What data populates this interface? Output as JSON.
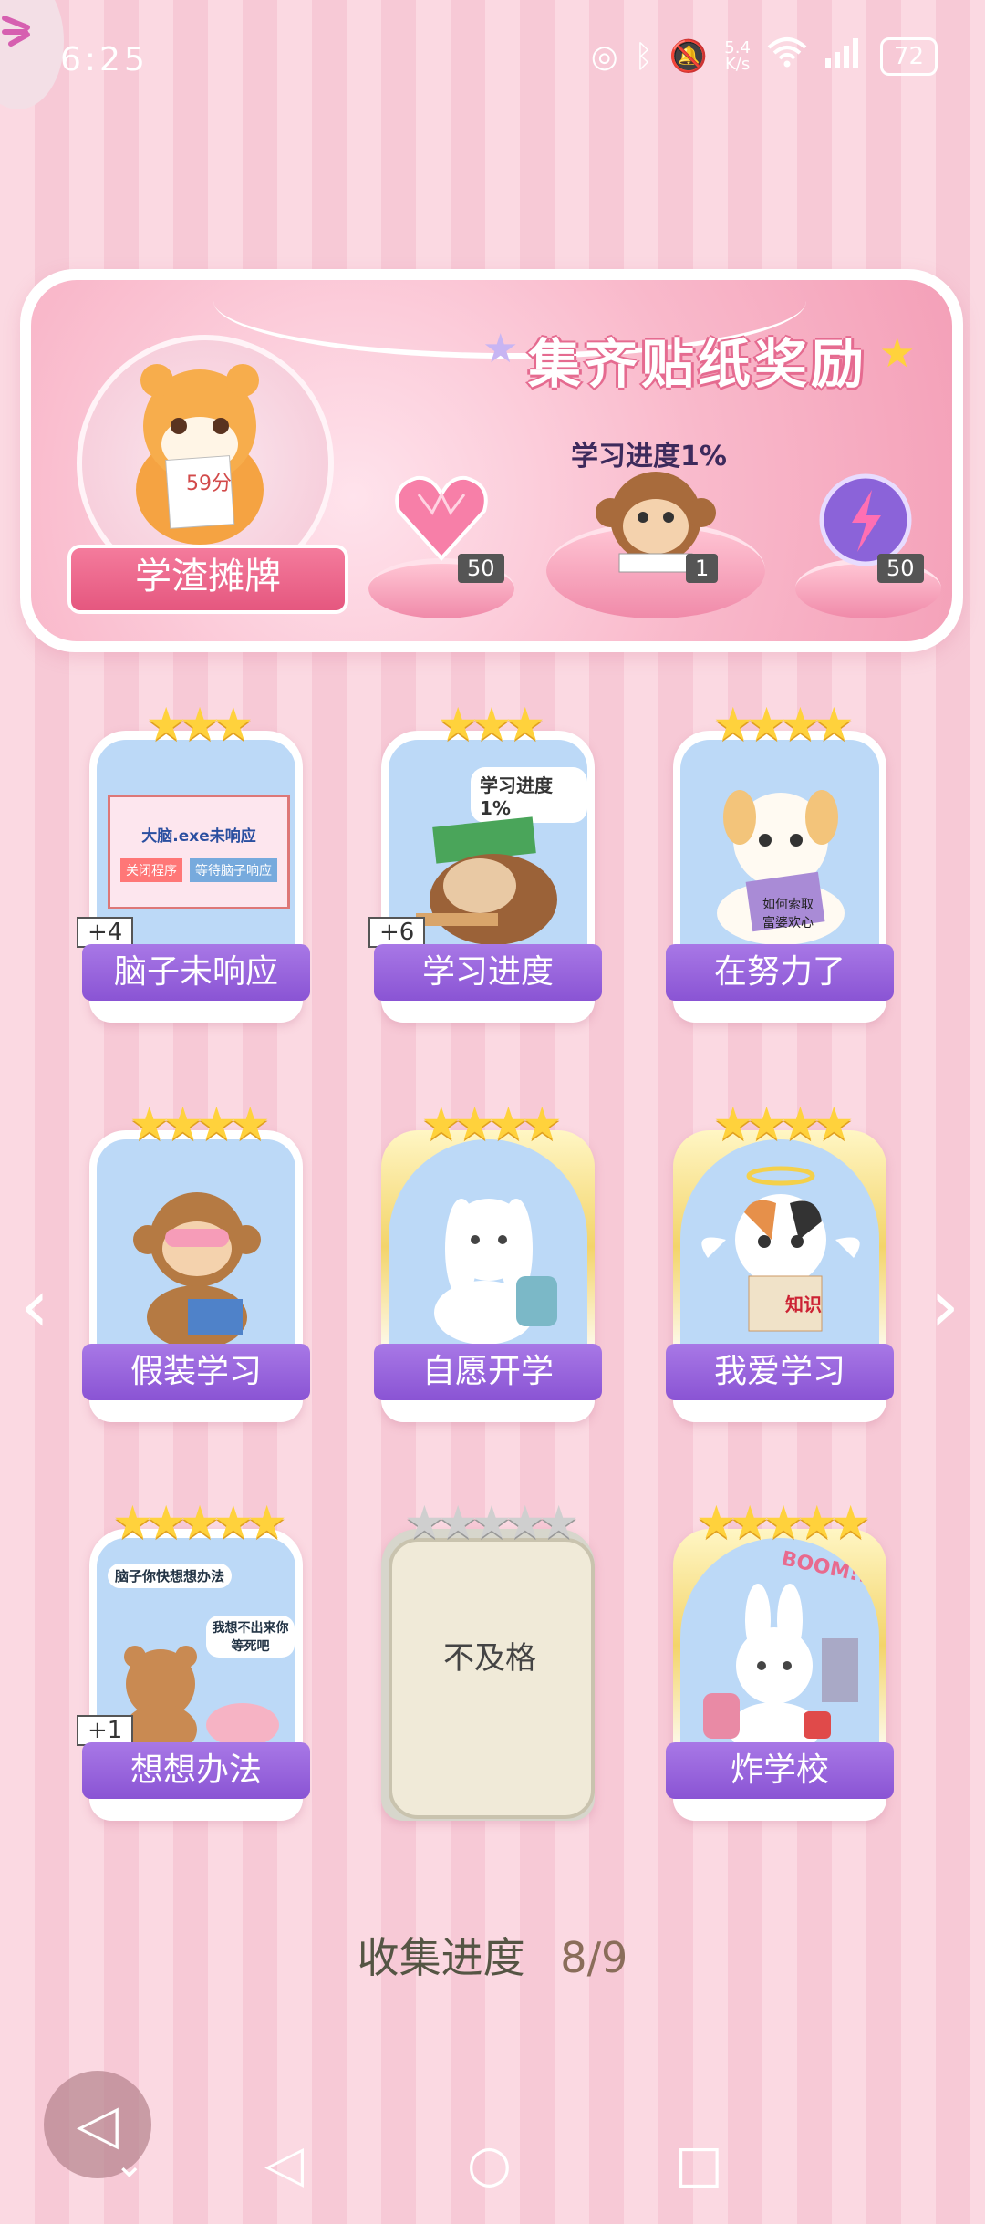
{
  "status_bar": {
    "time": "6:25",
    "net_speed_top": "5.4",
    "net_speed_bottom": "K/s",
    "battery": "72"
  },
  "banner": {
    "badge_label": "学渣摊牌",
    "title": "集齐贴纸奖励",
    "progress_label": "学习进度1%",
    "tiger_note": "59分",
    "rewards": [
      {
        "icon": "heart-gem-icon",
        "count": "50"
      },
      {
        "icon": "monkey-reading-icon",
        "count": "1"
      },
      {
        "icon": "purple-orb-icon",
        "count": "50"
      }
    ]
  },
  "stickers": [
    {
      "label": "脑子未响应",
      "stars": "★★★",
      "plus": "+4",
      "style": "blue",
      "art_text1": "大脑.exe未响应",
      "art_btn1": "关闭程序",
      "art_btn2": "等待脑子响应"
    },
    {
      "label": "学习进度",
      "stars": "★★★",
      "plus": "+6",
      "style": "blue",
      "art_text1": "学习进度1%"
    },
    {
      "label": "在努力了",
      "stars": "★★★★",
      "style": "blue",
      "art_text1": "如何索取富婆欢心"
    },
    {
      "label": "假装学习",
      "stars": "★★★★",
      "style": "blue"
    },
    {
      "label": "自愿开学",
      "stars": "★★★★",
      "style": "gold"
    },
    {
      "label": "我爱学习",
      "stars": "★★★★",
      "style": "gold",
      "art_text1": "知识"
    },
    {
      "label": "想想办法",
      "stars": "★★★★★",
      "plus": "+1",
      "style": "blue",
      "art_text1": "脑子你快想想办法",
      "art_text2": "我想不出来你等死吧"
    },
    {
      "label": "不及格",
      "stars": "★★★★★",
      "style": "locked"
    },
    {
      "label": "炸学校",
      "stars": "★★★★★",
      "style": "gold",
      "art_text1": "BOOM!!"
    }
  ],
  "collection": {
    "label": "收集进度",
    "value": "8/9"
  },
  "colors": {
    "accent_purple": "#8a54d4",
    "pink": "#f08aa9",
    "star": "#ffd23c"
  }
}
